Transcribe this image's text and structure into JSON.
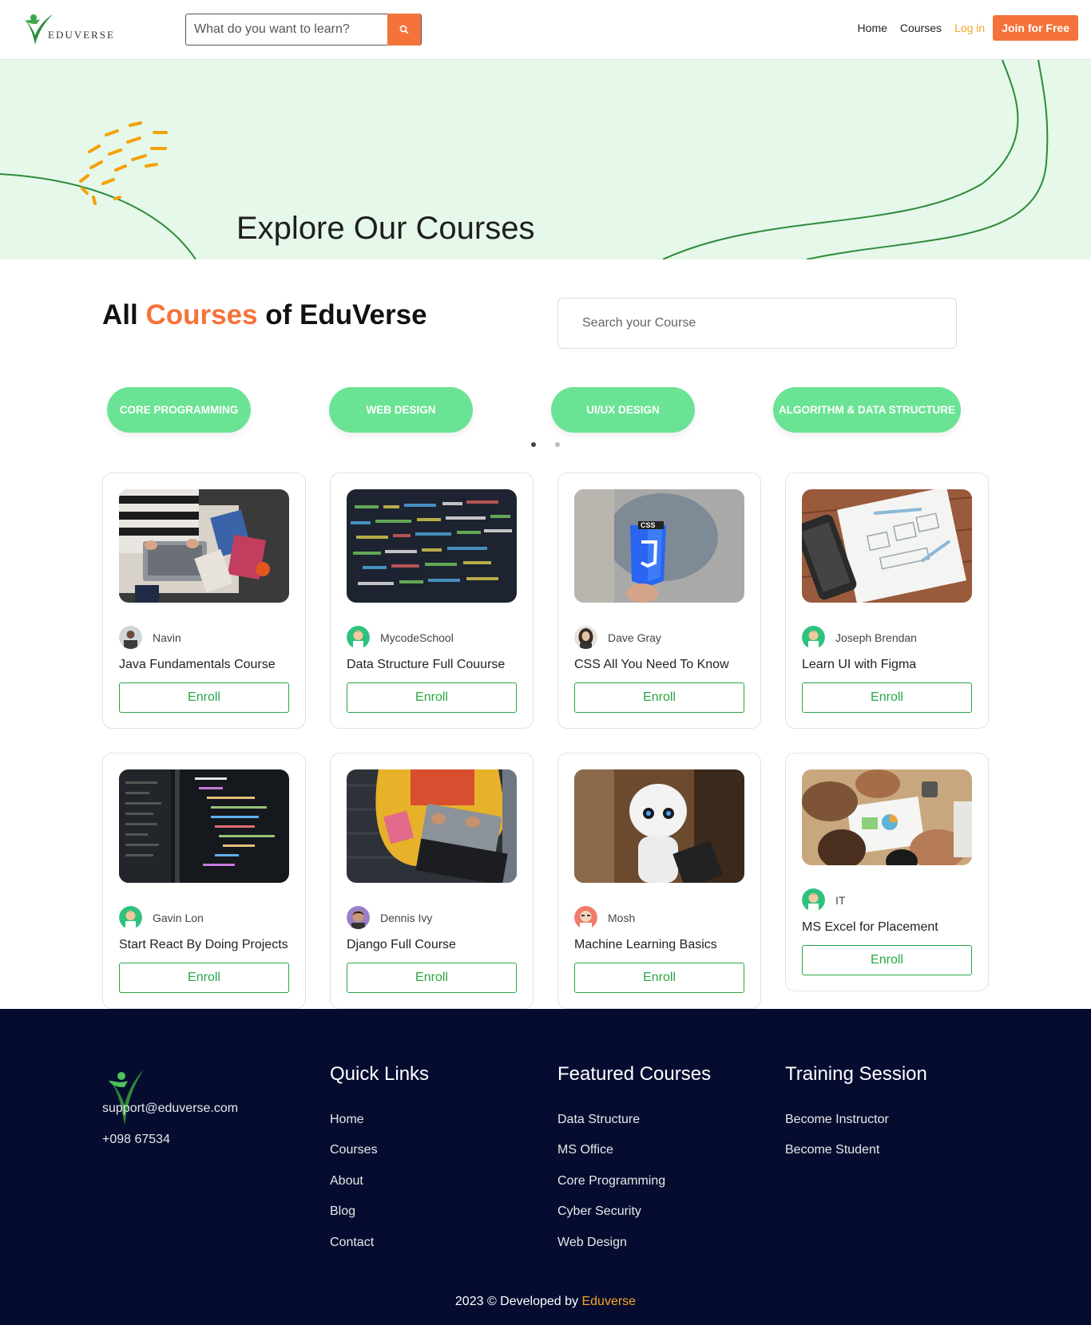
{
  "header": {
    "brand": "EDUVERSE",
    "search_placeholder": "What do you want to learn?",
    "search_icon": "search-icon",
    "nav": {
      "home": "Home",
      "courses": "Courses",
      "login": "Log in",
      "join": "Join for Free"
    }
  },
  "hero": {
    "title": "Explore Our Courses"
  },
  "all_courses": {
    "title_pre": "All",
    "title_accent": "Courses",
    "title_post": "of EduVerse",
    "search_placeholder": "Search your Course"
  },
  "categories": [
    "CORE PROGRAMMING",
    "WEB DESIGN",
    "UI/UX DESIGN",
    "ALGORITHM & DATA STRUCTURE"
  ],
  "courses": [
    {
      "author": "Navin",
      "title": "Java Fundamentals Course",
      "enroll": "Enroll"
    },
    {
      "author": "MycodeSchool",
      "title": "Data Structure Full Couurse",
      "enroll": "Enroll"
    },
    {
      "author": "Dave Gray",
      "title": "CSS All You Need To Know",
      "enroll": "Enroll"
    },
    {
      "author": "Joseph Brendan",
      "title": "Learn UI with Figma",
      "enroll": "Enroll"
    },
    {
      "author": "Gavin Lon",
      "title": "Start React By Doing Projects",
      "enroll": "Enroll"
    },
    {
      "author": "Dennis Ivy",
      "title": "Django Full Course",
      "enroll": "Enroll"
    },
    {
      "author": "Mosh",
      "title": "Machine Learning Basics",
      "enroll": "Enroll"
    },
    {
      "author": "IT",
      "title": "MS Excel for Placement",
      "enroll": "Enroll"
    }
  ],
  "footer": {
    "email": "support@eduverse.com",
    "phone": "+098 67534",
    "quick_links": {
      "title": "Quick Links",
      "items": [
        "Home",
        "Courses",
        "About",
        "Blog",
        "Contact"
      ]
    },
    "featured": {
      "title": "Featured Courses",
      "items": [
        "Data Structure",
        "MS Office",
        "Core Programming",
        "Cyber Security",
        "Web Design"
      ]
    },
    "training": {
      "title": "Training Session",
      "items": [
        "Become Instructor",
        "Become Student"
      ]
    },
    "copyright_pre": "2023 © Developed by",
    "copyright_brand": "Eduverse"
  },
  "colors": {
    "accent": "#f5733b",
    "green": "#6be394",
    "enroll": "#28a745",
    "footer_bg": "#060c30",
    "hero_bg": "#e5f8ea"
  }
}
